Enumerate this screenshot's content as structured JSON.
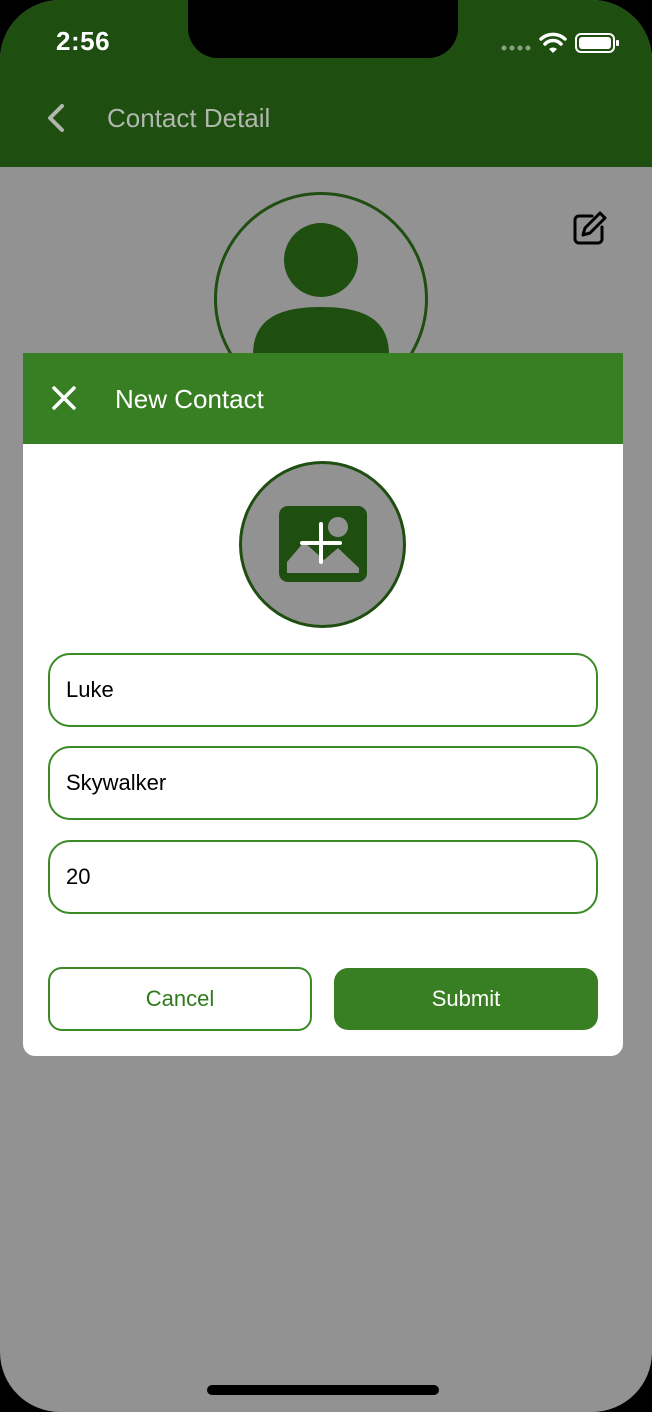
{
  "status_bar": {
    "time": "2:56"
  },
  "nav": {
    "title": "Contact Detail"
  },
  "modal": {
    "title": "New Contact",
    "fields": [
      {
        "value": "Luke"
      },
      {
        "value": "Skywalker"
      },
      {
        "value": "20"
      }
    ],
    "cancel_label": "Cancel",
    "submit_label": "Submit"
  },
  "colors": {
    "nav_bar": "#1f4e11",
    "modal_header": "#377f22",
    "accent": "#3a8a25",
    "backdrop": "#929292"
  }
}
